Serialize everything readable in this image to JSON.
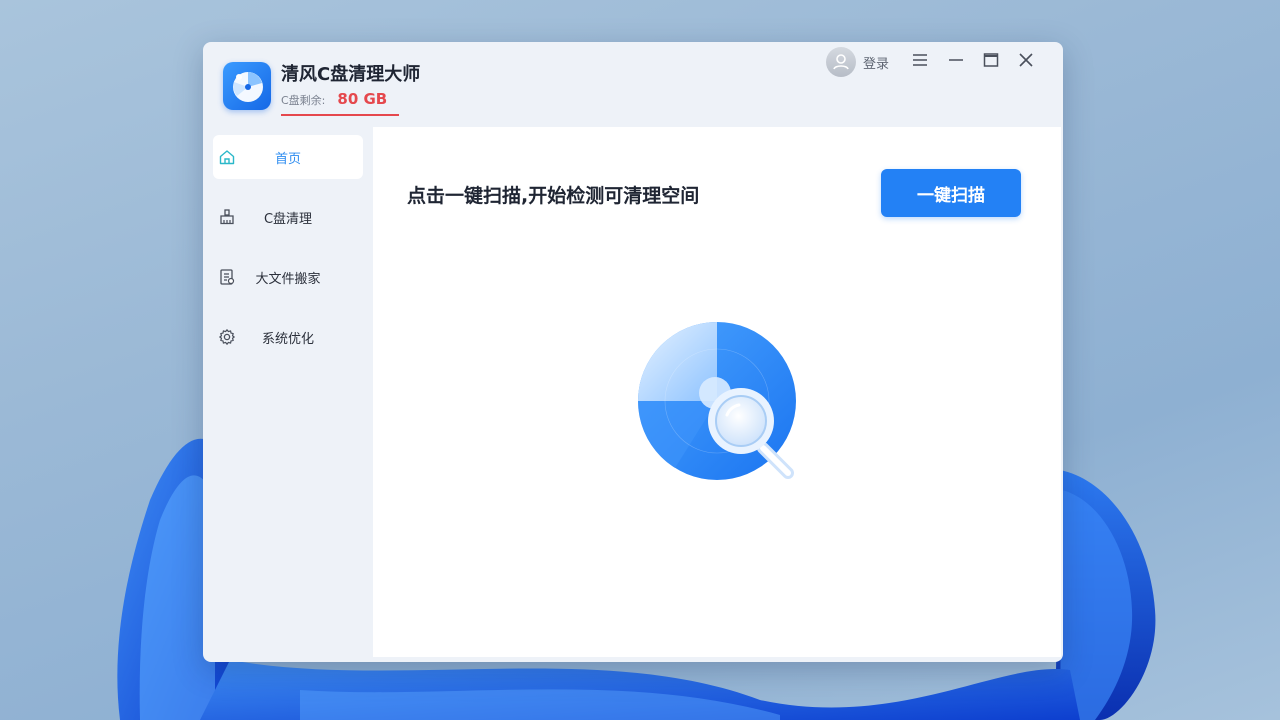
{
  "app": {
    "title": "清风C盘清理大师",
    "disk_free_label": "C盘剩余:",
    "disk_free_value": "80 GB",
    "accent_color": "#2381f5",
    "warning_color": "#e5484d"
  },
  "header": {
    "login_label": "登录",
    "icons": [
      "user-avatar-icon",
      "menu-icon",
      "minimize-icon",
      "maximize-icon",
      "close-icon"
    ]
  },
  "sidebar": {
    "items": [
      {
        "label": "首页",
        "icon": "home-icon",
        "active": true
      },
      {
        "label": "C盘清理",
        "icon": "broom-icon",
        "active": false
      },
      {
        "label": "大文件搬家",
        "icon": "document-icon",
        "active": false
      },
      {
        "label": "系统优化",
        "icon": "gear-icon",
        "active": false
      }
    ]
  },
  "main": {
    "prompt": "点击一键扫描,开始检测可清理空间",
    "scan_button_label": "一键扫描",
    "illustration": "scan-magnifier-icon"
  }
}
